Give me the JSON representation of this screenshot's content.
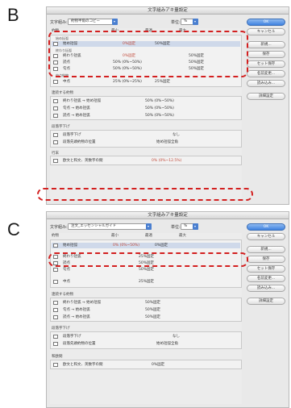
{
  "labels": {
    "b": "B",
    "c": "C"
  },
  "dialog_title": "文字組みアキ量設定",
  "common": {
    "ok": "OK",
    "cancel": "キャンセル",
    "new": "新規...",
    "save": "保存",
    "set_save": "セット保存",
    "rename": "名前変更...",
    "load": "読み込み...",
    "detail": "詳細設定",
    "unit_label": "単位:",
    "unit_value": "%",
    "col_min": "最小",
    "col_opt": "最適",
    "col_max": "最大"
  },
  "dialog_b": {
    "set_label": "文字組み:",
    "set_value": "約物半角のコピー",
    "sections": [
      "約物",
      "括弧との間",
      "連続する約物",
      "段落字下げ",
      "行末"
    ],
    "group_labels": [
      "始め括弧",
      "終わり括弧",
      "中点約物"
    ],
    "rows": [
      {
        "label": "始め括弧",
        "v1": "0%固定",
        "v2": "50%固定"
      },
      {
        "label": "終わり括弧",
        "v1": "0%固定",
        "v2": "50%固定"
      },
      {
        "label": "読点",
        "v1": "50% (0%~50%)",
        "v2": "50%固定"
      },
      {
        "label": "句点",
        "v1": "50% (0%~50%)",
        "v2": "50%固定"
      },
      {
        "label": "中点",
        "v1": "25% (0%~25%)",
        "v2": "25%固定"
      }
    ],
    "cont_rows": [
      {
        "label": "終わり括弧 → 始め括弧",
        "v1": "50% (0%~50%)"
      },
      {
        "label": "句点 → 始め括弧",
        "v1": "50% (0%~50%)"
      },
      {
        "label": "読点 → 始め括弧",
        "v1": "50% (0%~50%)"
      }
    ],
    "indent_rows": [
      {
        "label": "段落字下げ",
        "v1": "なし"
      },
      {
        "label": "段落先頭約物の位置",
        "v1": "始め括弧全角"
      }
    ],
    "last_row": {
      "label": "欧文と和文、英数字の間",
      "v1": "0% (0%~12.5%)"
    }
  },
  "dialog_c": {
    "set_label": "文字組み:",
    "set_value": "注文_エッセンシャルガイド",
    "sections": [
      "約物",
      "連続する約物",
      "段落字下げ",
      "和欧間"
    ],
    "rows": [
      {
        "label": "始め括弧",
        "v1": "0% (0%~50%)",
        "v2": "0%固定"
      },
      {
        "label": "終わり括弧",
        "v1": "25%固定",
        "v2": ""
      },
      {
        "label": "読点",
        "v1": "50%固定",
        "v2": ""
      },
      {
        "label": "句点",
        "v1": "50%固定",
        "v2": ""
      },
      {
        "label": "中点",
        "v1": "25%固定",
        "v2": ""
      }
    ],
    "cont_rows": [
      {
        "label": "終わり括弧 → 始め括弧",
        "v1": "50%固定"
      },
      {
        "label": "句点 → 始め括弧",
        "v1": "50%固定"
      },
      {
        "label": "読点 → 始め括弧",
        "v1": "50%固定"
      }
    ],
    "indent_rows": [
      {
        "label": "段落字下げ",
        "v1": "なし"
      },
      {
        "label": "段落先頭約物の位置",
        "v1": "始め括弧全角"
      }
    ],
    "last_row": {
      "label": "欧文と和文、英数字の間",
      "v1": "0%固定"
    }
  }
}
